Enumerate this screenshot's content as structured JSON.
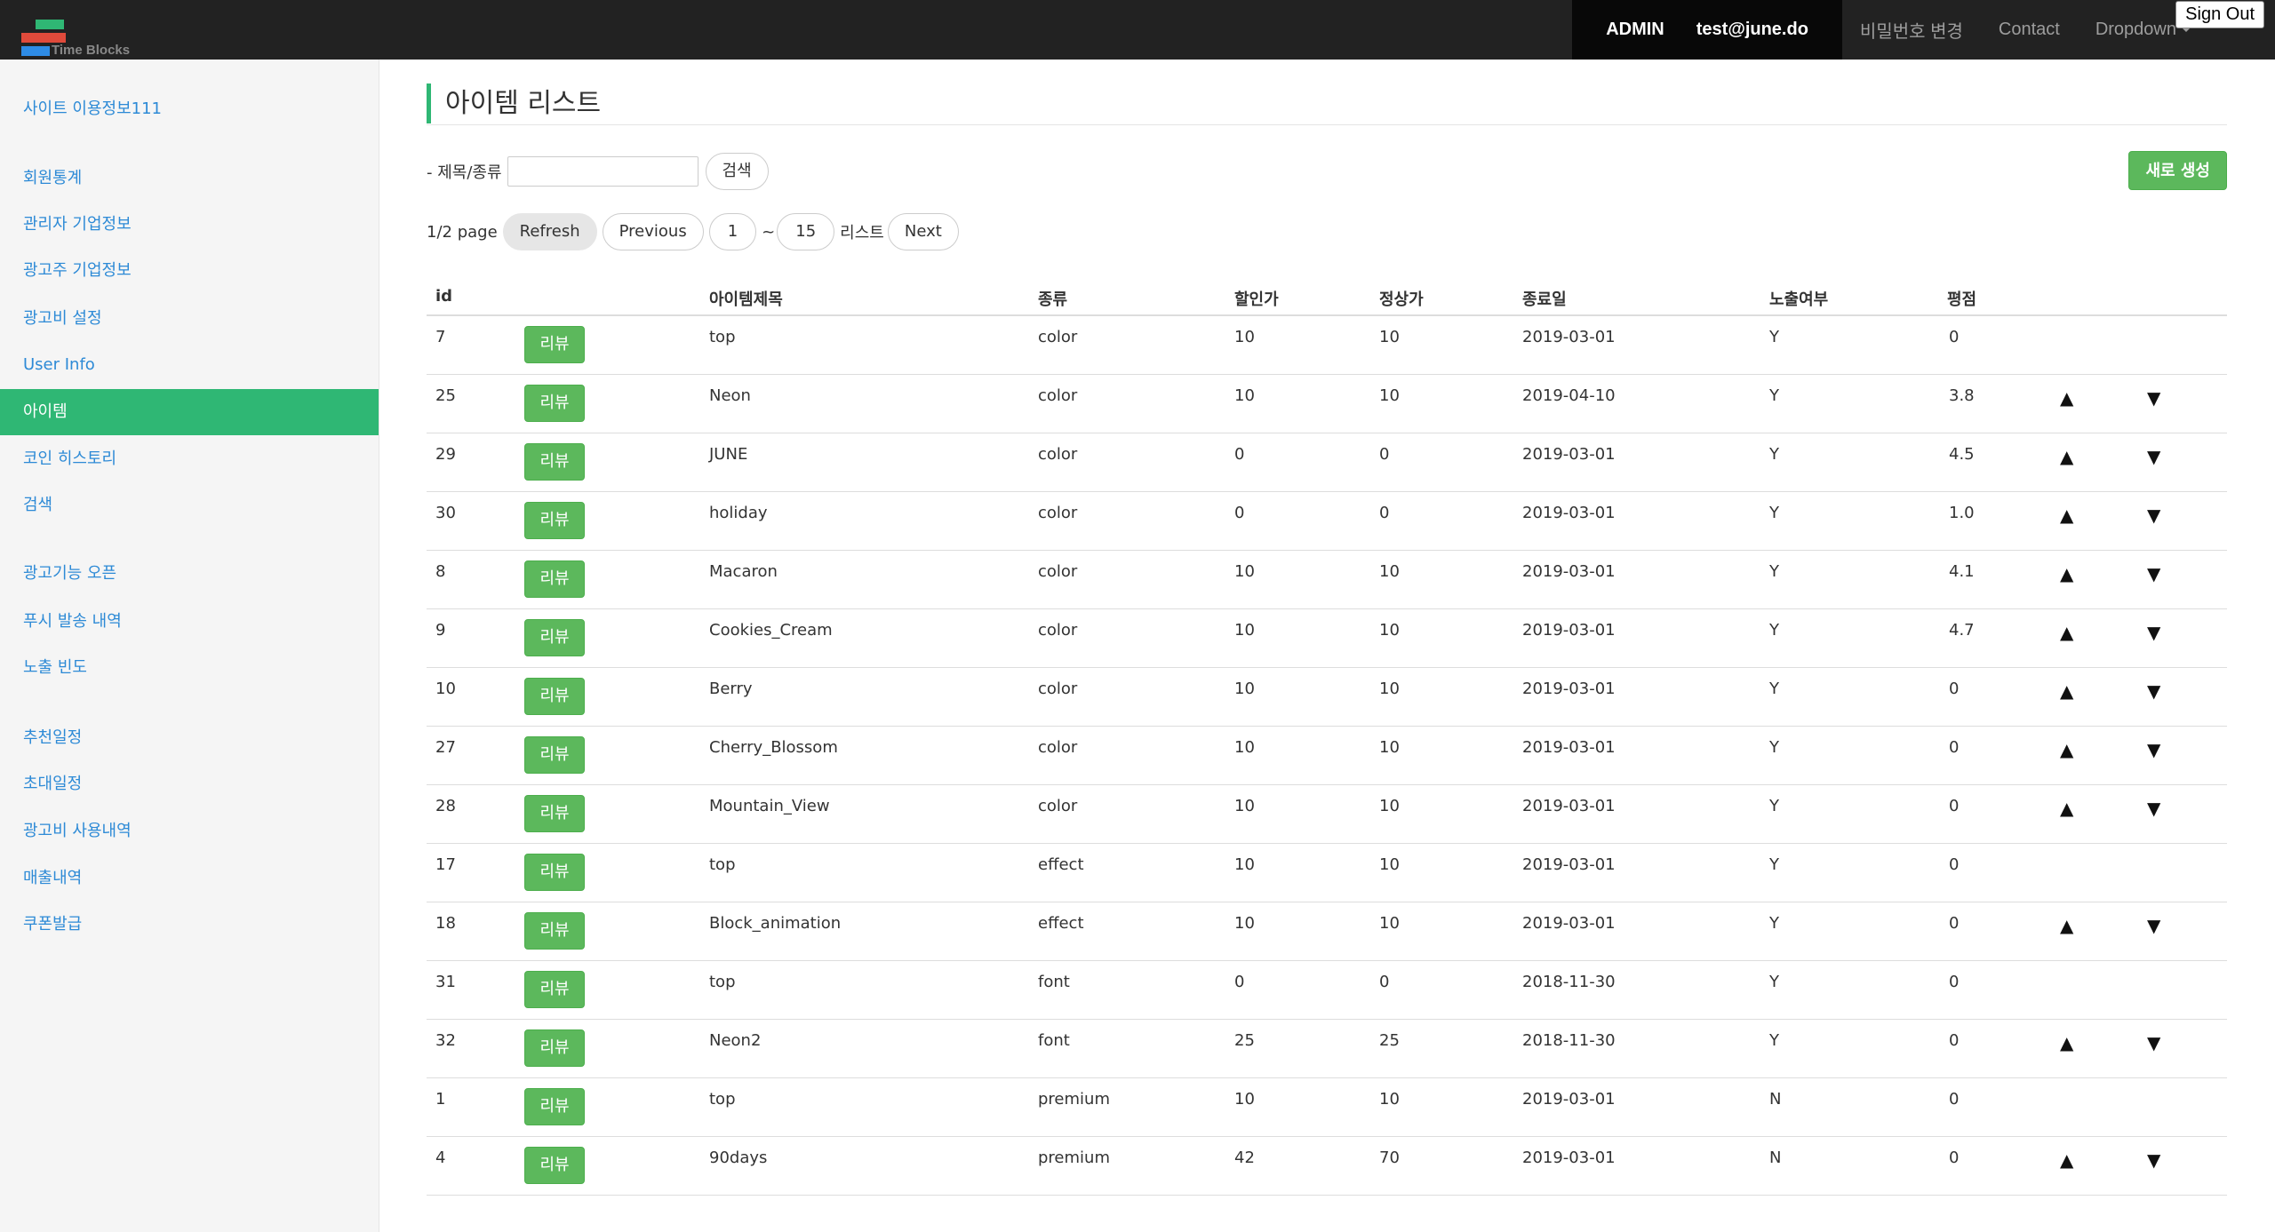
{
  "brand": {
    "name": "Time Blocks",
    "colors": {
      "green": "#2fb774",
      "red": "#e04a3b",
      "blue": "#2e8ce6"
    }
  },
  "nav": {
    "admin": "ADMIN",
    "email": "test@june.do",
    "change_password": "비밀번호 변경",
    "contact": "Contact",
    "dropdown": "Dropdown",
    "signout": "Sign Out"
  },
  "sidebar": {
    "items": [
      {
        "label": "사이트 이용정보111",
        "active": false
      },
      {
        "label": "회원통계",
        "active": false
      },
      {
        "label": "관리자 기업정보",
        "active": false
      },
      {
        "label": "광고주 기업정보",
        "active": false
      },
      {
        "label": "광고비 설정",
        "active": false
      },
      {
        "label": "User Info",
        "active": false
      },
      {
        "label": "아이템",
        "active": true
      },
      {
        "label": "코인 히스토리",
        "active": false
      },
      {
        "label": "검색",
        "active": false
      },
      {
        "label": "광고기능 오픈",
        "active": false
      },
      {
        "label": "푸시 발송 내역",
        "active": false
      },
      {
        "label": "노출 빈도",
        "active": false
      },
      {
        "label": "추천일정",
        "active": false
      },
      {
        "label": "초대일정",
        "active": false
      },
      {
        "label": "광고비 사용내역",
        "active": false
      },
      {
        "label": "매출내역",
        "active": false
      },
      {
        "label": "쿠폰발급",
        "active": false
      }
    ]
  },
  "main": {
    "title": "아이템 리스트",
    "search": {
      "label": "- 제목/종류",
      "value": "",
      "button": "검색"
    },
    "new_button": "새로 생성",
    "pager": {
      "page_info": "1/2 page",
      "refresh": "Refresh",
      "previous": "Previous",
      "from": "1",
      "tilde": "~",
      "to": "15",
      "list_label": "리스트",
      "next": "Next"
    },
    "table": {
      "headers": [
        "id",
        "아이템제목",
        "종류",
        "할인가",
        "정상가",
        "종료일",
        "노출여부",
        "평점"
      ],
      "review_label": "리뷰",
      "up_arrow": "▲",
      "down_arrow": "▼",
      "rows": [
        {
          "id": "7",
          "title": "top",
          "type": "color",
          "sale": "10",
          "price": "10",
          "end": "2019-03-01",
          "visible": "Y",
          "rating": "0",
          "arrows": false
        },
        {
          "id": "25",
          "title": "Neon",
          "type": "color",
          "sale": "10",
          "price": "10",
          "end": "2019-04-10",
          "visible": "Y",
          "rating": "3.8",
          "arrows": true
        },
        {
          "id": "29",
          "title": "JUNE",
          "type": "color",
          "sale": "0",
          "price": "0",
          "end": "2019-03-01",
          "visible": "Y",
          "rating": "4.5",
          "arrows": true
        },
        {
          "id": "30",
          "title": "holiday",
          "type": "color",
          "sale": "0",
          "price": "0",
          "end": "2019-03-01",
          "visible": "Y",
          "rating": "1.0",
          "arrows": true
        },
        {
          "id": "8",
          "title": "Macaron",
          "type": "color",
          "sale": "10",
          "price": "10",
          "end": "2019-03-01",
          "visible": "Y",
          "rating": "4.1",
          "arrows": true
        },
        {
          "id": "9",
          "title": "Cookies_Cream",
          "type": "color",
          "sale": "10",
          "price": "10",
          "end": "2019-03-01",
          "visible": "Y",
          "rating": "4.7",
          "arrows": true
        },
        {
          "id": "10",
          "title": "Berry",
          "type": "color",
          "sale": "10",
          "price": "10",
          "end": "2019-03-01",
          "visible": "Y",
          "rating": "0",
          "arrows": true
        },
        {
          "id": "27",
          "title": "Cherry_Blossom",
          "type": "color",
          "sale": "10",
          "price": "10",
          "end": "2019-03-01",
          "visible": "Y",
          "rating": "0",
          "arrows": true
        },
        {
          "id": "28",
          "title": "Mountain_View",
          "type": "color",
          "sale": "10",
          "price": "10",
          "end": "2019-03-01",
          "visible": "Y",
          "rating": "0",
          "arrows": true
        },
        {
          "id": "17",
          "title": "top",
          "type": "effect",
          "sale": "10",
          "price": "10",
          "end": "2019-03-01",
          "visible": "Y",
          "rating": "0",
          "arrows": false
        },
        {
          "id": "18",
          "title": "Block_animation",
          "type": "effect",
          "sale": "10",
          "price": "10",
          "end": "2019-03-01",
          "visible": "Y",
          "rating": "0",
          "arrows": true
        },
        {
          "id": "31",
          "title": "top",
          "type": "font",
          "sale": "0",
          "price": "0",
          "end": "2018-11-30",
          "visible": "Y",
          "rating": "0",
          "arrows": false
        },
        {
          "id": "32",
          "title": "Neon2",
          "type": "font",
          "sale": "25",
          "price": "25",
          "end": "2018-11-30",
          "visible": "Y",
          "rating": "0",
          "arrows": true
        },
        {
          "id": "1",
          "title": "top",
          "type": "premium",
          "sale": "10",
          "price": "10",
          "end": "2019-03-01",
          "visible": "N",
          "rating": "0",
          "arrows": false
        },
        {
          "id": "4",
          "title": "90days",
          "type": "premium",
          "sale": "42",
          "price": "70",
          "end": "2019-03-01",
          "visible": "N",
          "rating": "0",
          "arrows": true
        }
      ]
    }
  }
}
